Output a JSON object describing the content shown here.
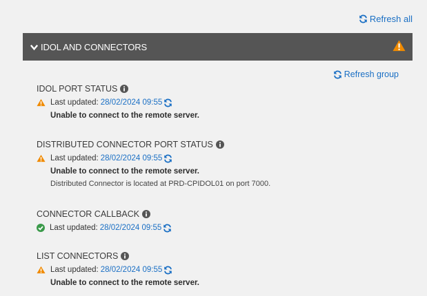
{
  "toolbar": {
    "refresh_all_label": "Refresh all"
  },
  "group": {
    "title": "IDOL AND CONNECTORS",
    "refresh_group_label": "Refresh group",
    "status_icon": "warning-icon"
  },
  "colors": {
    "accent": "#1a6fc4",
    "warning": "#f08a00",
    "ok": "#3a9a4a",
    "header_bg": "#555555",
    "page_bg": "#f1f1f1"
  },
  "sections": [
    {
      "title": "IDOL PORT STATUS",
      "status": "warning",
      "last_updated_label": "Last updated:",
      "timestamp": "28/02/2024 09:55",
      "message": "Unable to connect to the remote server.",
      "detail": ""
    },
    {
      "title": "DISTRIBUTED CONNECTOR PORT STATUS",
      "status": "warning",
      "last_updated_label": "Last updated:",
      "timestamp": "28/02/2024 09:55",
      "message": "Unable to connect to the remote server.",
      "detail": "Distributed Connector is located at PRD-CPIDOL01 on port 7000."
    },
    {
      "title": "CONNECTOR CALLBACK",
      "status": "ok",
      "last_updated_label": "Last updated:",
      "timestamp": "28/02/2024 09:55",
      "message": "",
      "detail": ""
    },
    {
      "title": "LIST CONNECTORS",
      "status": "warning",
      "last_updated_label": "Last updated:",
      "timestamp": "28/02/2024 09:55",
      "message": "Unable to connect to the remote server.",
      "detail": ""
    }
  ]
}
